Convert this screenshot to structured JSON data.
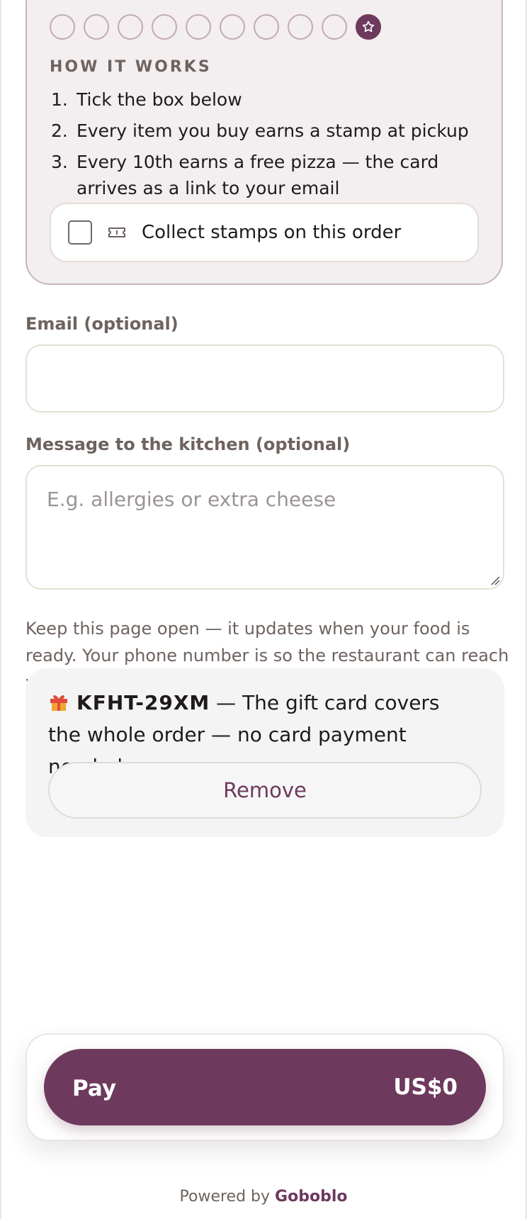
{
  "loyalty": {
    "stamps_total": 10,
    "stamps_collected": 0,
    "reward_icon": "star-icon",
    "how_title": "HOW IT WORKS",
    "steps": [
      {
        "num": "1.",
        "text": "Tick the box below"
      },
      {
        "num": "2.",
        "text": "Every item you buy earns a stamp at pickup"
      },
      {
        "num": "3.",
        "text": "Every 10th earns a free pizza — the card arrives as a link to your email"
      }
    ],
    "collect_label": "Collect stamps on this order",
    "collect_checked": false,
    "collect_icon": "ticket-icon"
  },
  "form": {
    "email_label": "Email (optional)",
    "email_value": "",
    "email_placeholder": "",
    "message_label": "Message to the kitchen (optional)",
    "message_value": "",
    "message_placeholder": "E.g. allergies or extra cheese"
  },
  "hint": "Keep this page open — it updates when your food is ready. Your phone number is so the restaurant can reach you.",
  "gift_card": {
    "icon": "gift-icon",
    "code": "KFHT-29XM",
    "message": " — The gift card covers the whole order — no card payment needed.",
    "remove_label": "Remove"
  },
  "pay": {
    "label": "Pay",
    "amount": "US$0"
  },
  "footer": {
    "prefix": "Powered by ",
    "brand": "Goboblo"
  },
  "colors": {
    "accent": "#6d3a5d",
    "card_bg": "#f3eeef",
    "muted_text": "#6e635f"
  }
}
